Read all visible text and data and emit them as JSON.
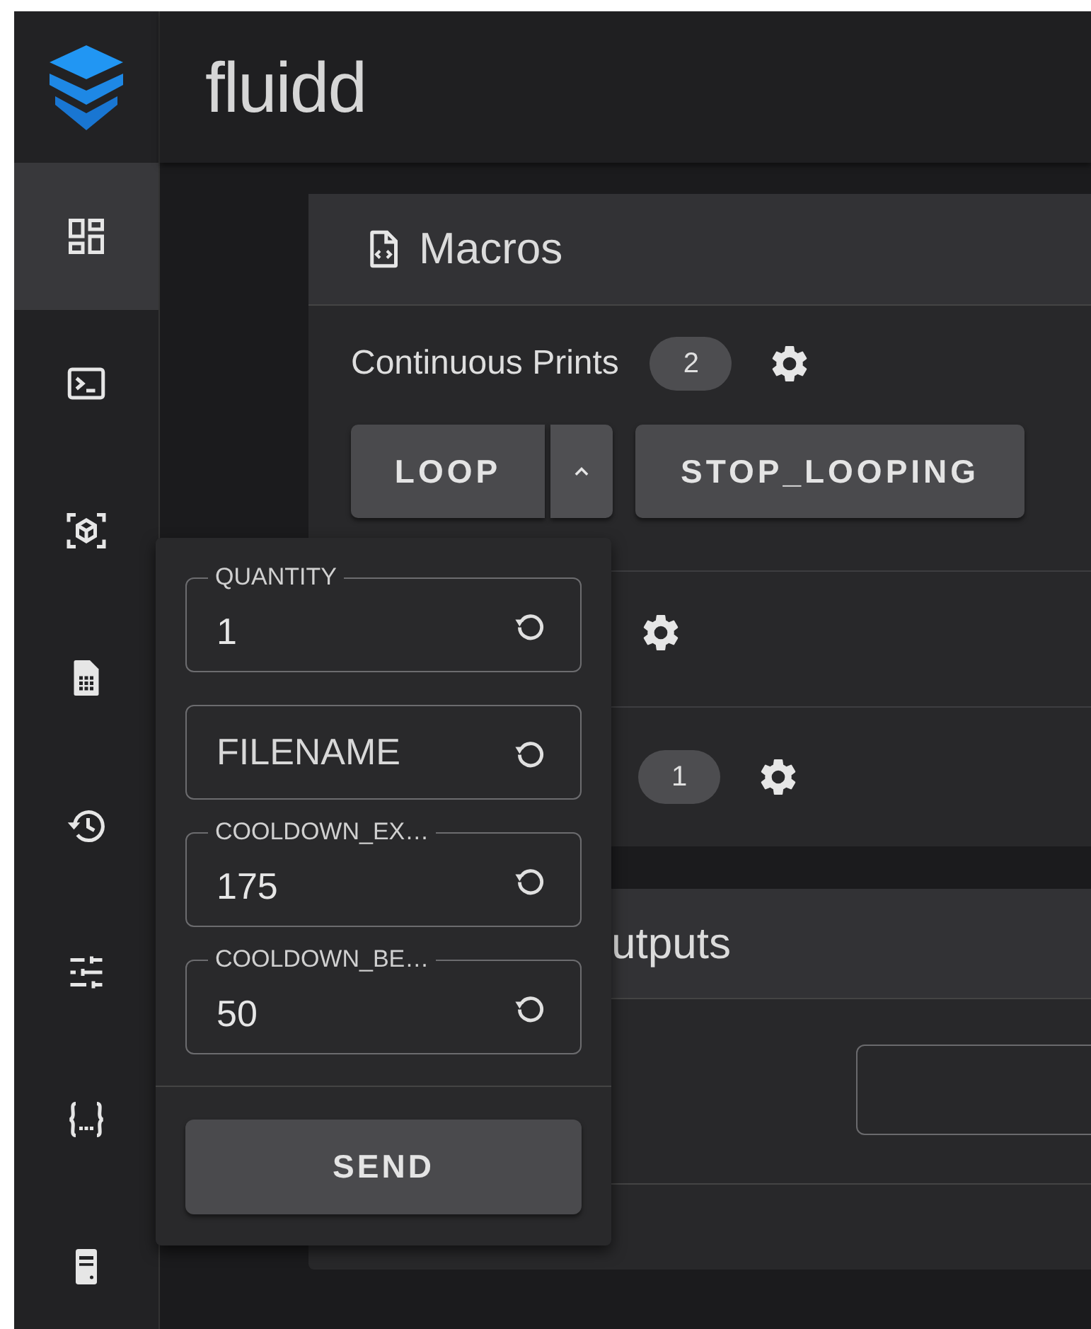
{
  "app": {
    "title": "fluidd"
  },
  "nav": [
    {
      "kind": "dashboard",
      "selected": true
    },
    {
      "kind": "console",
      "selected": false
    },
    {
      "kind": "cube",
      "selected": false
    },
    {
      "kind": "document",
      "selected": false
    },
    {
      "kind": "history",
      "selected": false
    },
    {
      "kind": "tune",
      "selected": false
    },
    {
      "kind": "braces",
      "selected": false
    },
    {
      "kind": "server",
      "selected": false
    }
  ],
  "macros": {
    "title": "Macros",
    "groups": [
      {
        "kind": "group",
        "label": "Continuous Prints",
        "count": "2",
        "buttons": [
          {
            "kind": "split",
            "label": "LOOP",
            "expanded": true
          },
          {
            "kind": "plain",
            "label": "STOP_LOOPING"
          }
        ]
      },
      {
        "kind": "group"
      },
      {
        "kind": "group",
        "count": "1"
      }
    ]
  },
  "popup": {
    "fields": [
      {
        "label": "QUANTITY",
        "value": "1"
      },
      {
        "placeholder": "FILENAME"
      },
      {
        "label": "COOLDOWN_EX…",
        "value": "175"
      },
      {
        "label": "COOLDOWN_BE…",
        "value": "50"
      }
    ],
    "button": "SEND"
  },
  "outputs": {
    "title": "utputs"
  }
}
